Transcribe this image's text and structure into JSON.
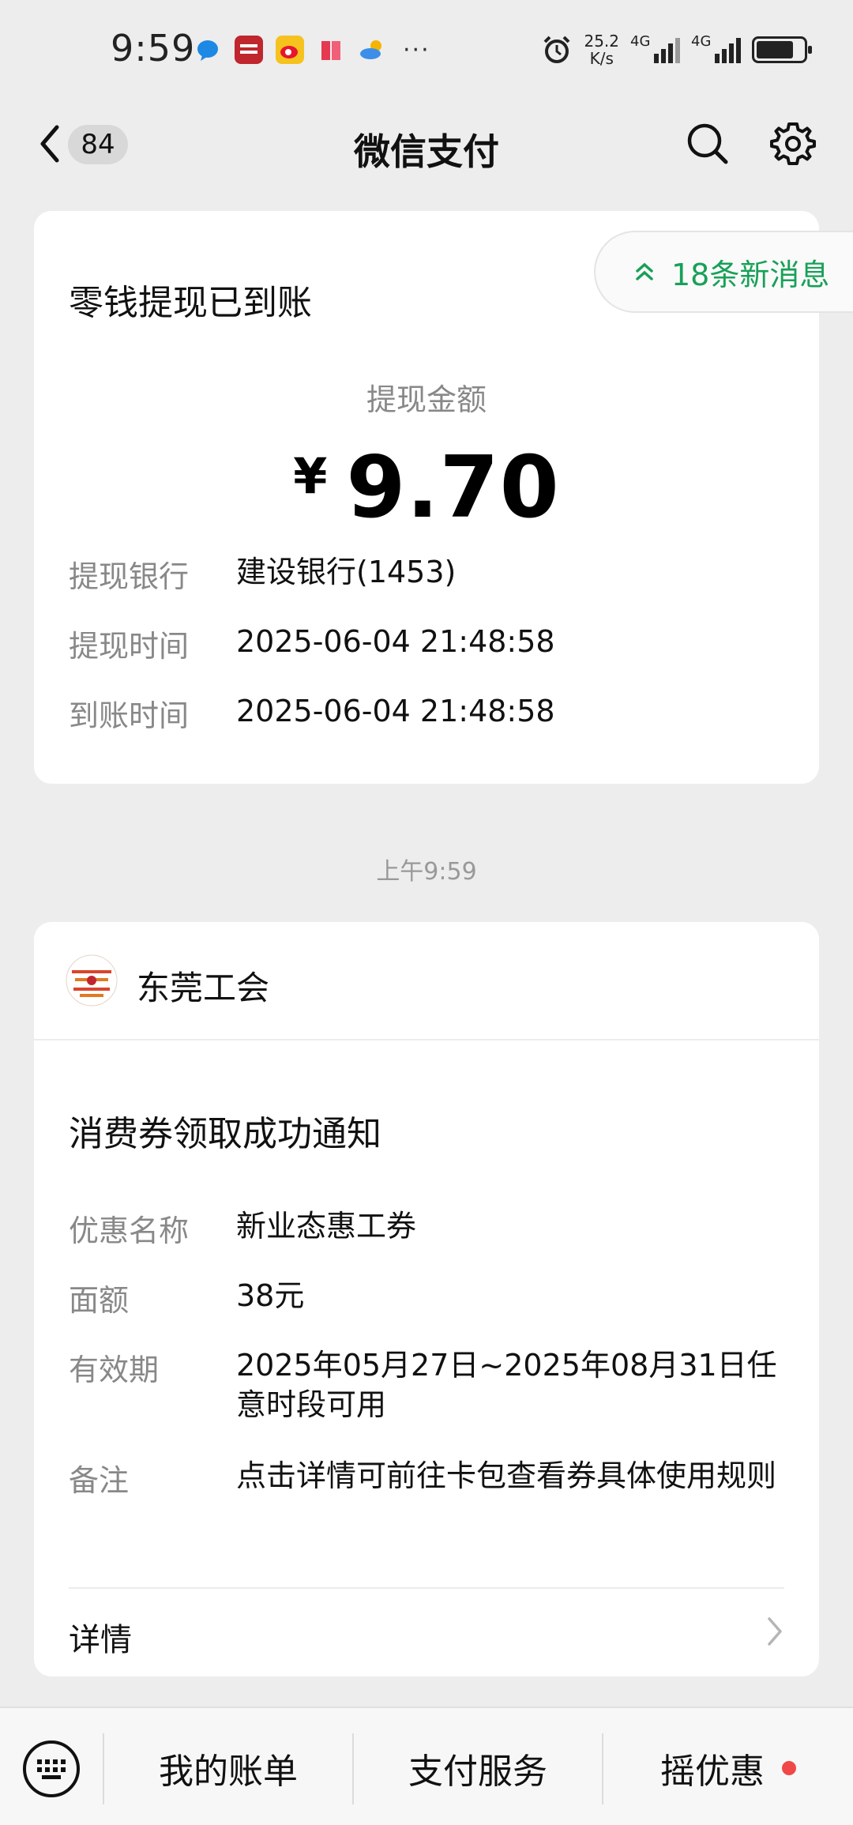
{
  "status_bar": {
    "time": "9:59",
    "net_speed_value": "25.2",
    "net_speed_unit": "K/s",
    "sim1": "4G",
    "sim2": "4G",
    "more": "···",
    "app_icons": [
      "messages-icon",
      "leishen-app-icon",
      "weibo-icon",
      "book-app-icon",
      "weather-icon"
    ],
    "battery_level": 0.8
  },
  "nav": {
    "back_count": "84",
    "title": "微信支付"
  },
  "withdrawal_card": {
    "heading": "零钱提现已到账",
    "amount_label": "提现金额",
    "currency": "¥",
    "amount": "9.70",
    "rows": [
      {
        "key": "提现银行",
        "value": "建设银行(1453)"
      },
      {
        "key": "提现时间",
        "value": "2025-06-04 21:48:58"
      },
      {
        "key": "到账时间",
        "value": "2025-06-04 21:48:58"
      }
    ]
  },
  "new_messages": {
    "label": "18条新消息"
  },
  "timestamp": "上午9:59",
  "coupon_card": {
    "org_name": "东莞工会",
    "heading": "消费券领取成功通知",
    "rows": [
      {
        "key": "优惠名称",
        "value": "新业态惠工券"
      },
      {
        "key": "面额",
        "value": "38元"
      },
      {
        "key": "有效期",
        "value": "2025年05月27日~2025年08月31日任意时段可用"
      },
      {
        "key": "备注",
        "value": "点击详情可前往卡包查看券具体使用规则"
      }
    ],
    "detail_label": "详情"
  },
  "bottom_bar": {
    "tabs": [
      "我的账单",
      "支付服务",
      "摇优惠"
    ]
  },
  "colors": {
    "accent_green": "#18a058",
    "badge_red": "#f04848",
    "page_bg": "#ededed"
  }
}
